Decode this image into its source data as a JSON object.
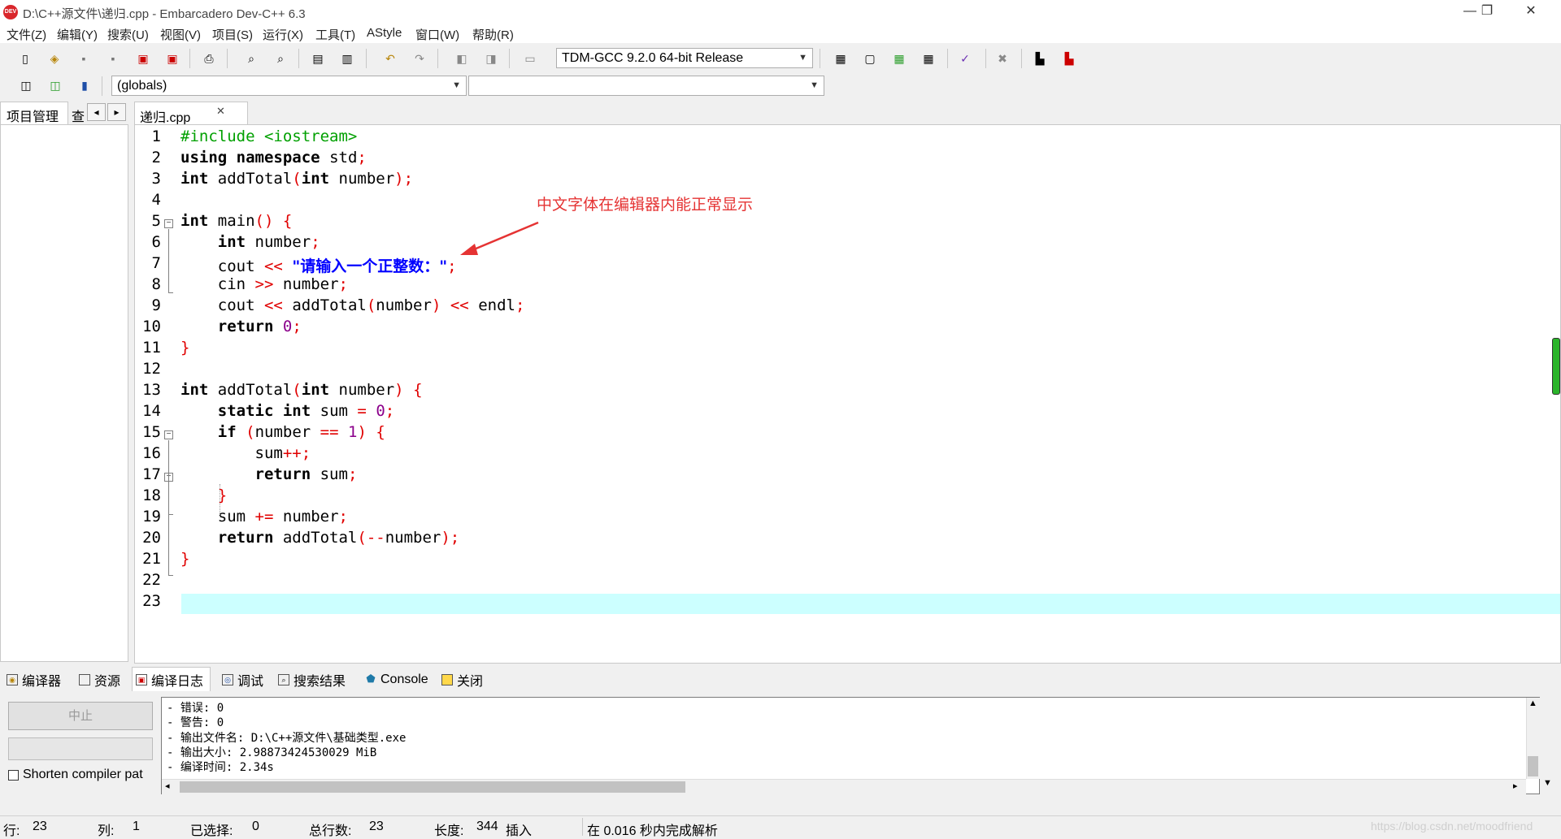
{
  "window": {
    "title": "D:\\C++源文件\\递归.cpp - Embarcadero Dev-C++ 6.3",
    "icon_label": "DEV C++",
    "controls": [
      "—",
      "❐",
      "✕"
    ]
  },
  "menu": [
    "文件(Z)",
    "编辑(Y)",
    "搜索(U)",
    "视图(V)",
    "项目(S)",
    "运行(X)",
    "工具(T)",
    "AStyle",
    "窗口(W)",
    "帮助(R)"
  ],
  "toolbar": {
    "compiler_select": "TDM-GCC 9.2.0 64-bit Release",
    "scope_select": "(globals)",
    "function_select": ""
  },
  "left_panel": {
    "tabs": [
      "项目管理",
      "查"
    ],
    "nav_prev": "◂",
    "nav_next": "▸"
  },
  "editor": {
    "tab_label": "递归.cpp",
    "tab_close": "✕",
    "line_numbers": [
      "1",
      "2",
      "3",
      "4",
      "5",
      "6",
      "7",
      "8",
      "9",
      "10",
      "11",
      "12",
      "13",
      "14",
      "15",
      "16",
      "17",
      "18",
      "19",
      "20",
      "21",
      "22",
      "23"
    ],
    "lines": [
      "#include <iostream>",
      "using namespace std;",
      "int addTotal(int number);",
      "",
      "int main() {",
      "    int number;",
      "    cout << \"请输入一个正整数：\";",
      "    cin >> number;",
      "    cout << addTotal(number) << endl;",
      "    return 0;",
      "}",
      "",
      "int addTotal(int number) {",
      "    static int sum = 0;",
      "    if (number == 1) {",
      "        sum++;",
      "        return sum;",
      "    }",
      "    sum += number;",
      "    return addTotal(--number);",
      "}",
      "",
      ""
    ],
    "active_line": 23,
    "annotation": "中文字体在编辑器内能正常显示"
  },
  "bottom_panel": {
    "tabs": [
      "编译器",
      "资源",
      "编译日志",
      "调试",
      "搜索结果",
      "Console",
      "关闭"
    ],
    "active_tab": "编译日志",
    "stop_button": "中止",
    "shorten_label": "Shorten compiler pat",
    "log_lines": [
      "- 错误: 0",
      "- 警告: 0",
      "- 输出文件名: D:\\C++源文件\\基础类型.exe",
      "- 输出大小: 2.98873424530029 MiB",
      "- 编译时间: 2.34s"
    ]
  },
  "statusbar": {
    "row_label": "行:",
    "row_value": "23",
    "col_label": "列:",
    "col_value": "1",
    "sel_label": "已选择:",
    "sel_value": "0",
    "total_label": "总行数:",
    "total_value": "23",
    "len_label": "长度:",
    "len_value": "344",
    "mode": "插入",
    "parse_info": "在 0.016 秒内完成解析",
    "watermark": "https://blog.csdn.net/moodfriend"
  }
}
